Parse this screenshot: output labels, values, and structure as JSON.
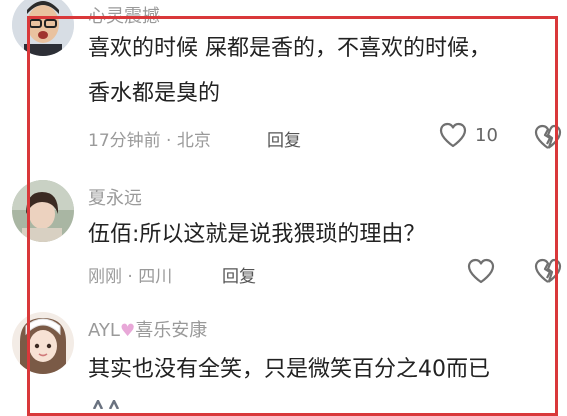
{
  "comments": [
    {
      "username": "心灵震撼",
      "lines": [
        "喜欢的时候 屎都是香的，不喜欢的时候，",
        "香水都是臭的"
      ],
      "meta": "17分钟前 · 北京",
      "reply_label": "回复",
      "likes": "10"
    },
    {
      "username": "夏永远",
      "lines": [
        "伍佰:所以这就是说我猥琐的理由？"
      ],
      "meta": "刚刚 · 四川",
      "reply_label": "回复",
      "likes": ""
    },
    {
      "username_prefix": "AYL",
      "username_suffix": "喜乐安康",
      "lines": [
        "其实也没有全笑，只是微笑百分之40而已"
      ]
    }
  ],
  "colors": {
    "highlight": "#d9383a",
    "text": "#222222",
    "muted": "#9a9a9a",
    "heart_emoji": "#e8a8d8"
  },
  "icons": [
    "heart-outline-icon",
    "broken-heart-icon",
    "purple-heart-emoji"
  ]
}
